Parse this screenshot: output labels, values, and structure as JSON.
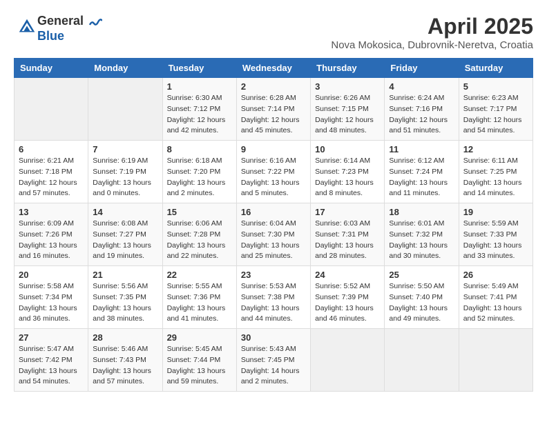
{
  "header": {
    "logo_general": "General",
    "logo_blue": "Blue",
    "month_year": "April 2025",
    "location": "Nova Mokosica, Dubrovnik-Neretva, Croatia"
  },
  "calendar": {
    "days_of_week": [
      "Sunday",
      "Monday",
      "Tuesday",
      "Wednesday",
      "Thursday",
      "Friday",
      "Saturday"
    ],
    "rows": [
      [
        {
          "day": "",
          "info": ""
        },
        {
          "day": "",
          "info": ""
        },
        {
          "day": "1",
          "info": "Sunrise: 6:30 AM\nSunset: 7:12 PM\nDaylight: 12 hours and 42 minutes."
        },
        {
          "day": "2",
          "info": "Sunrise: 6:28 AM\nSunset: 7:14 PM\nDaylight: 12 hours and 45 minutes."
        },
        {
          "day": "3",
          "info": "Sunrise: 6:26 AM\nSunset: 7:15 PM\nDaylight: 12 hours and 48 minutes."
        },
        {
          "day": "4",
          "info": "Sunrise: 6:24 AM\nSunset: 7:16 PM\nDaylight: 12 hours and 51 minutes."
        },
        {
          "day": "5",
          "info": "Sunrise: 6:23 AM\nSunset: 7:17 PM\nDaylight: 12 hours and 54 minutes."
        }
      ],
      [
        {
          "day": "6",
          "info": "Sunrise: 6:21 AM\nSunset: 7:18 PM\nDaylight: 12 hours and 57 minutes."
        },
        {
          "day": "7",
          "info": "Sunrise: 6:19 AM\nSunset: 7:19 PM\nDaylight: 13 hours and 0 minutes."
        },
        {
          "day": "8",
          "info": "Sunrise: 6:18 AM\nSunset: 7:20 PM\nDaylight: 13 hours and 2 minutes."
        },
        {
          "day": "9",
          "info": "Sunrise: 6:16 AM\nSunset: 7:22 PM\nDaylight: 13 hours and 5 minutes."
        },
        {
          "day": "10",
          "info": "Sunrise: 6:14 AM\nSunset: 7:23 PM\nDaylight: 13 hours and 8 minutes."
        },
        {
          "day": "11",
          "info": "Sunrise: 6:12 AM\nSunset: 7:24 PM\nDaylight: 13 hours and 11 minutes."
        },
        {
          "day": "12",
          "info": "Sunrise: 6:11 AM\nSunset: 7:25 PM\nDaylight: 13 hours and 14 minutes."
        }
      ],
      [
        {
          "day": "13",
          "info": "Sunrise: 6:09 AM\nSunset: 7:26 PM\nDaylight: 13 hours and 16 minutes."
        },
        {
          "day": "14",
          "info": "Sunrise: 6:08 AM\nSunset: 7:27 PM\nDaylight: 13 hours and 19 minutes."
        },
        {
          "day": "15",
          "info": "Sunrise: 6:06 AM\nSunset: 7:28 PM\nDaylight: 13 hours and 22 minutes."
        },
        {
          "day": "16",
          "info": "Sunrise: 6:04 AM\nSunset: 7:30 PM\nDaylight: 13 hours and 25 minutes."
        },
        {
          "day": "17",
          "info": "Sunrise: 6:03 AM\nSunset: 7:31 PM\nDaylight: 13 hours and 28 minutes."
        },
        {
          "day": "18",
          "info": "Sunrise: 6:01 AM\nSunset: 7:32 PM\nDaylight: 13 hours and 30 minutes."
        },
        {
          "day": "19",
          "info": "Sunrise: 5:59 AM\nSunset: 7:33 PM\nDaylight: 13 hours and 33 minutes."
        }
      ],
      [
        {
          "day": "20",
          "info": "Sunrise: 5:58 AM\nSunset: 7:34 PM\nDaylight: 13 hours and 36 minutes."
        },
        {
          "day": "21",
          "info": "Sunrise: 5:56 AM\nSunset: 7:35 PM\nDaylight: 13 hours and 38 minutes."
        },
        {
          "day": "22",
          "info": "Sunrise: 5:55 AM\nSunset: 7:36 PM\nDaylight: 13 hours and 41 minutes."
        },
        {
          "day": "23",
          "info": "Sunrise: 5:53 AM\nSunset: 7:38 PM\nDaylight: 13 hours and 44 minutes."
        },
        {
          "day": "24",
          "info": "Sunrise: 5:52 AM\nSunset: 7:39 PM\nDaylight: 13 hours and 46 minutes."
        },
        {
          "day": "25",
          "info": "Sunrise: 5:50 AM\nSunset: 7:40 PM\nDaylight: 13 hours and 49 minutes."
        },
        {
          "day": "26",
          "info": "Sunrise: 5:49 AM\nSunset: 7:41 PM\nDaylight: 13 hours and 52 minutes."
        }
      ],
      [
        {
          "day": "27",
          "info": "Sunrise: 5:47 AM\nSunset: 7:42 PM\nDaylight: 13 hours and 54 minutes."
        },
        {
          "day": "28",
          "info": "Sunrise: 5:46 AM\nSunset: 7:43 PM\nDaylight: 13 hours and 57 minutes."
        },
        {
          "day": "29",
          "info": "Sunrise: 5:45 AM\nSunset: 7:44 PM\nDaylight: 13 hours and 59 minutes."
        },
        {
          "day": "30",
          "info": "Sunrise: 5:43 AM\nSunset: 7:45 PM\nDaylight: 14 hours and 2 minutes."
        },
        {
          "day": "",
          "info": ""
        },
        {
          "day": "",
          "info": ""
        },
        {
          "day": "",
          "info": ""
        }
      ]
    ]
  }
}
